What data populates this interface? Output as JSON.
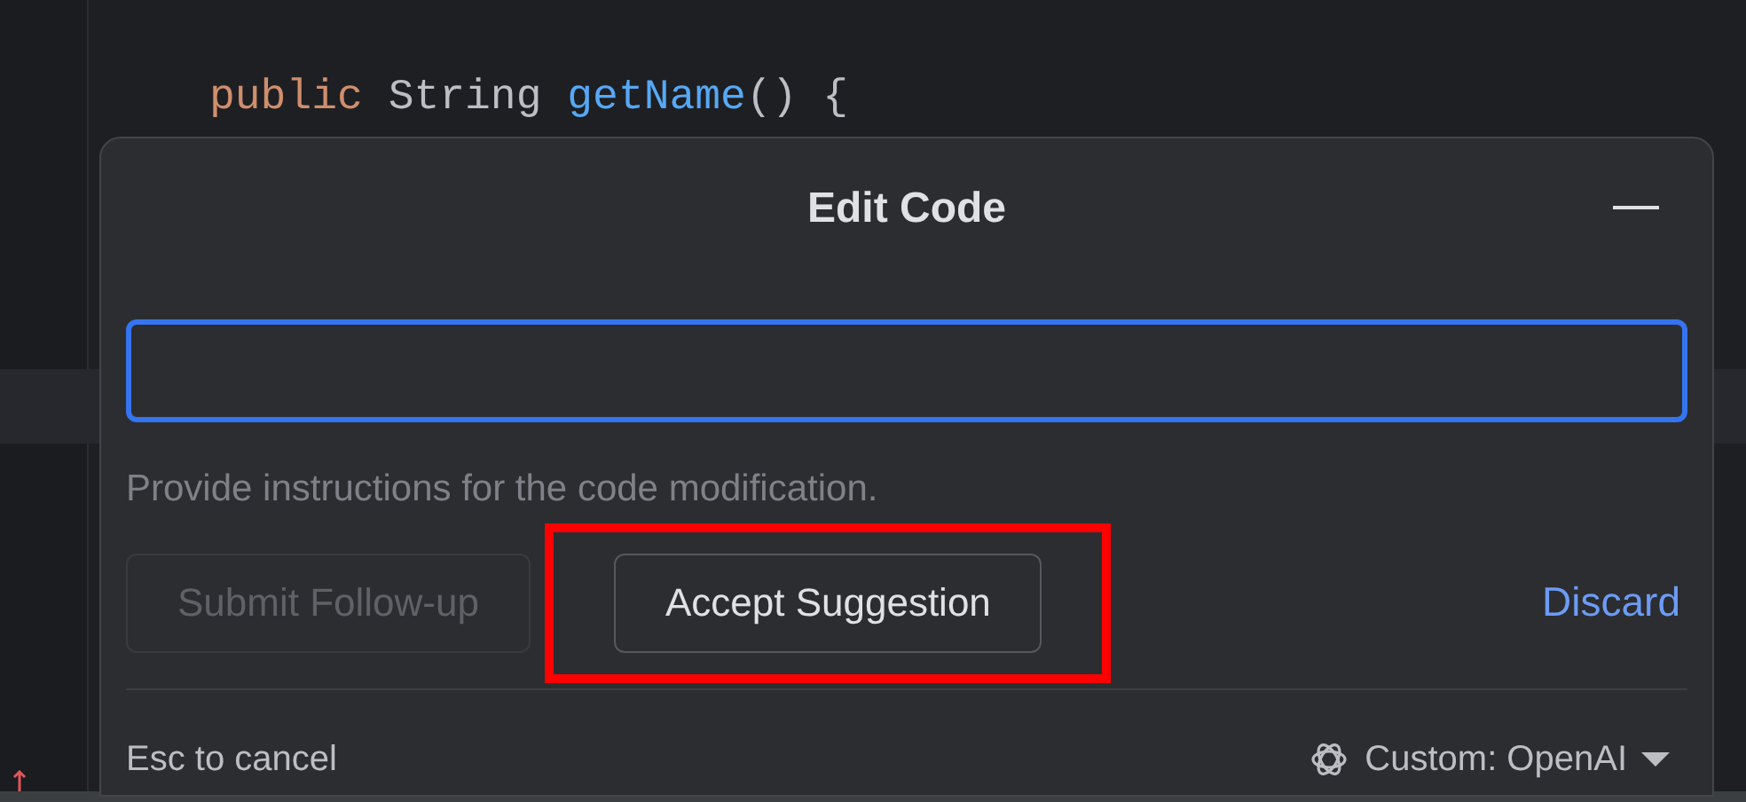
{
  "code_line": [
    {
      "text": "public",
      "kind": "keyword"
    },
    {
      "text": " String ",
      "kind": "plain"
    },
    {
      "text": "getName",
      "kind": "function"
    },
    {
      "text": "() {",
      "kind": "plain"
    }
  ],
  "dialog": {
    "title": "Edit Code",
    "instruction_field": {
      "focused": true
    },
    "hint": "Provide instructions for the code modification.",
    "buttons": [
      {
        "label": "Submit Follow-up",
        "kind": "outline",
        "disabled": true,
        "highlighted": false
      },
      {
        "label": "Accept Suggestion",
        "kind": "outline",
        "disabled": false,
        "highlighted": true
      },
      {
        "label": "Discard",
        "kind": "link",
        "disabled": false,
        "highlighted": false
      }
    ],
    "footer": {
      "shortcut_hint": "Esc to cancel",
      "model": "Custom: OpenAI"
    }
  }
}
